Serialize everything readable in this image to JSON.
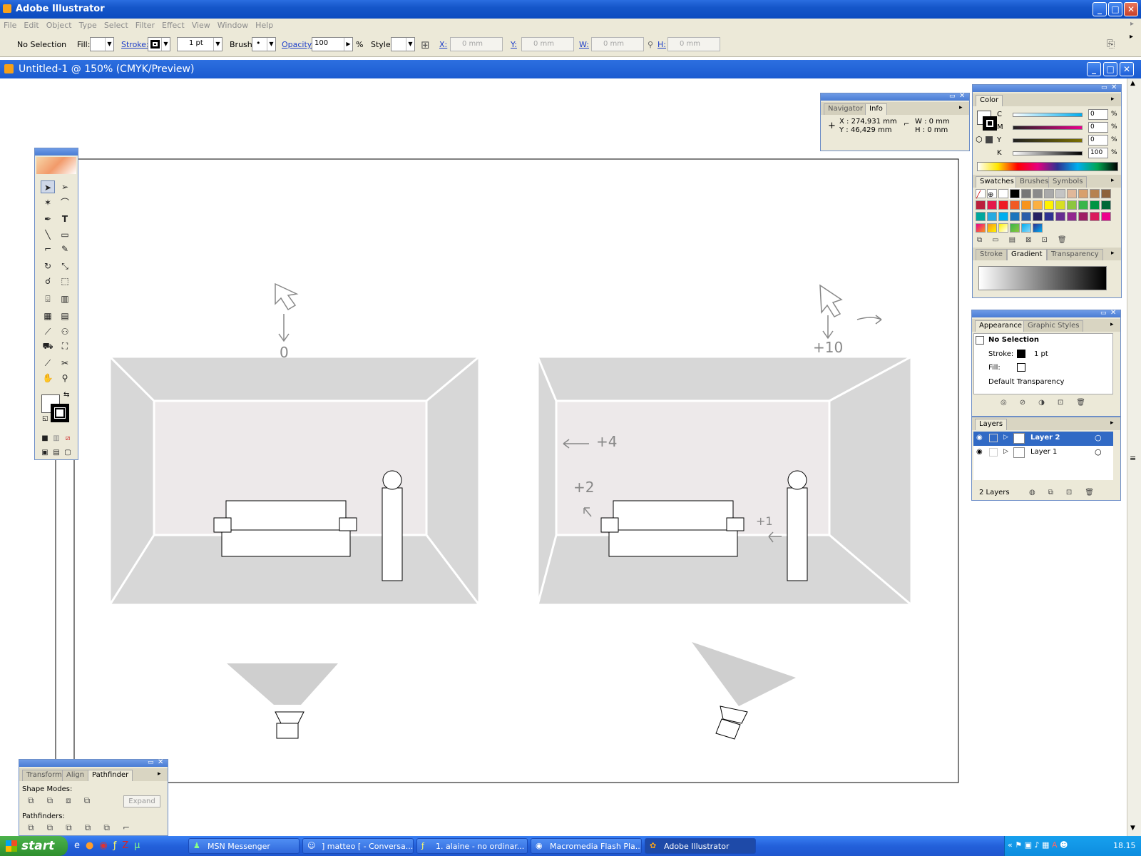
{
  "app": {
    "title": "Adobe Illustrator"
  },
  "menu": [
    "File",
    "Edit",
    "Object",
    "Type",
    "Select",
    "Filter",
    "Effect",
    "View",
    "Window",
    "Help"
  ],
  "control_bar": {
    "selection": "No Selection",
    "fill_label": "Fill:",
    "stroke_label": "Stroke:",
    "stroke_weight": "1 pt",
    "brush_label": "Brush:",
    "opacity_label": "Opacity:",
    "opacity_value": "100",
    "percent": "%",
    "style_label": "Style:",
    "x_label": "X:",
    "x_value": "0 mm",
    "y_label": "Y:",
    "y_value": "0 mm",
    "w_label": "W:",
    "w_value": "0 mm",
    "h_label": "H:",
    "h_value": "0 mm"
  },
  "document": {
    "title": "Untitled-1 @ 150% (CMYK/Preview)"
  },
  "navigator": {
    "tabs": [
      "Navigator",
      "Info"
    ],
    "x": "X : 274,931 mm",
    "y": "Y : 46,429 mm",
    "w": "W : 0 mm",
    "h": "H : 0 mm"
  },
  "color_panel": {
    "tab": "Color",
    "channels": [
      {
        "label": "C",
        "value": "0"
      },
      {
        "label": "M",
        "value": "0"
      },
      {
        "label": "Y",
        "value": "0"
      },
      {
        "label": "K",
        "value": "100"
      }
    ],
    "unit": "%"
  },
  "swatches_panel": {
    "tabs": [
      "Swatches",
      "Brushes",
      "Symbols"
    ]
  },
  "gradient_panel": {
    "tabs": [
      "Stroke",
      "Gradient",
      "Transparency"
    ]
  },
  "appearance_panel": {
    "tabs": [
      "Appearance",
      "Graphic Styles"
    ],
    "selection": "No Selection",
    "stroke_label": "Stroke:",
    "stroke_value": "1 pt",
    "fill_label": "Fill:",
    "transparency": "Default Transparency"
  },
  "layers_panel": {
    "tab": "Layers",
    "layers": [
      {
        "name": "Layer 2",
        "selected": true
      },
      {
        "name": "Layer 1",
        "selected": false
      }
    ],
    "count": "2 Layers"
  },
  "pathfinder_panel": {
    "tabs": [
      "Transform",
      "Align",
      "Pathfinder"
    ],
    "shape_modes": "Shape Modes:",
    "expand": "Expand",
    "pathfinders": "Pathfinders:"
  },
  "artwork": {
    "annotations": [
      "0",
      "+10",
      "+4",
      "+2",
      "+1"
    ]
  },
  "taskbar": {
    "start": "start",
    "tasks": [
      {
        "label": "MSN Messenger",
        "active": false
      },
      {
        "label": "] matteo [ - Conversa...",
        "active": false
      },
      {
        "label": "1. alaine - no ordinar...",
        "active": false
      },
      {
        "label": "Macromedia Flash Pla...",
        "active": false
      },
      {
        "label": "Adobe Illustrator",
        "active": true
      }
    ],
    "clock": "18.15"
  },
  "colors": {
    "xp_blue": "#1556c9",
    "panel_bg": "#ece9d8",
    "selected_layer": "#316ac5",
    "start_green": "#2d8f2d"
  }
}
